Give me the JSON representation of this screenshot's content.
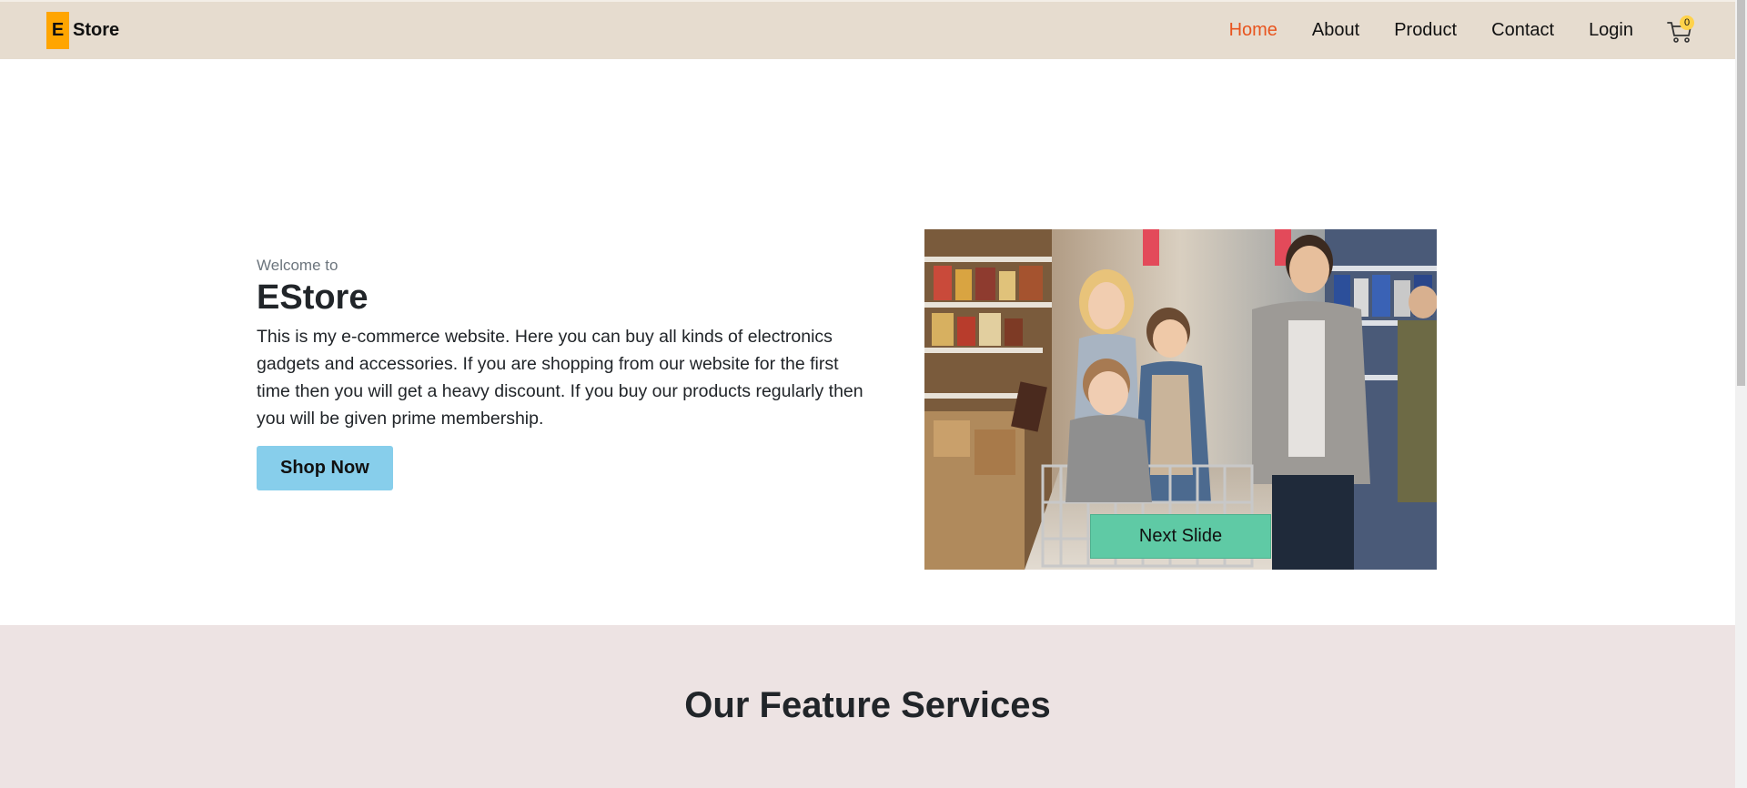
{
  "navbar": {
    "brand_letter": "E",
    "brand_text": "Store",
    "links": [
      "Home",
      "About",
      "Product",
      "Contact",
      "Login"
    ],
    "active_link": "Home",
    "cart_count": "0",
    "cart_icon": "shopping-cart-icon"
  },
  "hero": {
    "welcome": "Welcome to",
    "title": "EStore",
    "description": "This is my e-commerce website. Here you can buy all kinds of electronics gadgets and accessories. If you are shopping from our website for the first time then you will get a heavy discount. If you buy our products regularly then you will be given prime membership.",
    "cta_label": "Shop Now",
    "next_slide_label": "Next Slide"
  },
  "features": {
    "title": "Our Feature Services"
  },
  "colors": {
    "navbar_bg": "#e6dccf",
    "brand_badge": "#ffa500",
    "active_link": "#e8541e",
    "cta_bg": "#87ceeb",
    "next_slide_bg": "#5fcaa5",
    "features_bg": "#ede3e3"
  }
}
